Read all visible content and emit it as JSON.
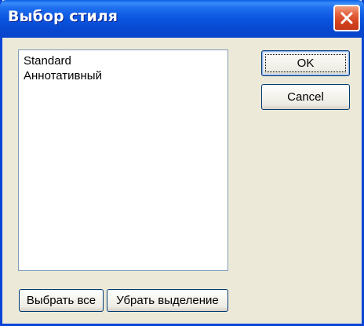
{
  "dialog": {
    "title": "Выбор стиля",
    "close_icon": "close-icon"
  },
  "styles_list": {
    "items": [
      "Standard",
      "Аннотативный"
    ]
  },
  "buttons": {
    "ok": "OK",
    "cancel": "Cancel",
    "select_all": "Выбрать все",
    "deselect": "Убрать выделение"
  },
  "colors": {
    "titlebar": "#0a55df",
    "close_button": "#e4603b",
    "dialog_background": "#ece9d8",
    "button_border": "#003c74"
  }
}
